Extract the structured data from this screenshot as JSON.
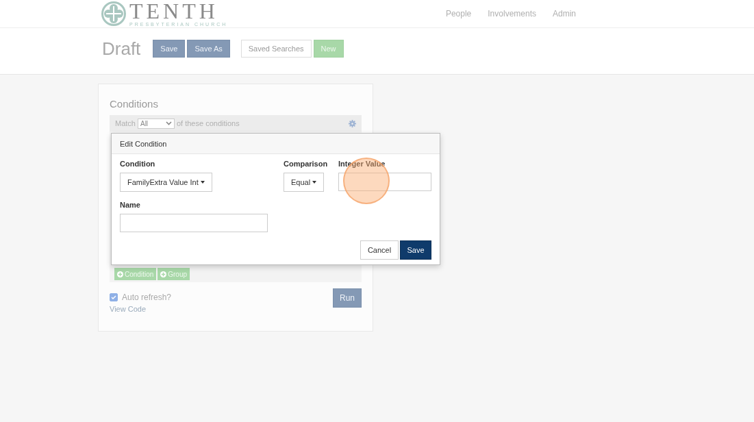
{
  "header": {
    "logo": {
      "name": "TENTH",
      "subtitle": "PRESBYTERIAN CHURCH"
    },
    "nav": [
      "People",
      "Involvements",
      "Admin"
    ]
  },
  "toolbar": {
    "title": "Draft",
    "buttons": [
      {
        "label": "Save",
        "kind": "primary"
      },
      {
        "label": "Save As",
        "kind": "primary"
      },
      {
        "label": "Saved Searches",
        "kind": "default"
      },
      {
        "label": "New",
        "kind": "success"
      }
    ]
  },
  "conditions": {
    "title": "Conditions",
    "match": {
      "prefix": "Match",
      "value": "All",
      "suffix": "of these conditions"
    },
    "add_buttons": [
      "Condition",
      "Group"
    ],
    "auto_refresh": {
      "label": "Auto refresh?",
      "checked": true
    },
    "run_button": "Run",
    "view_code": "View Code"
  },
  "dialog": {
    "title": "Edit Condition",
    "condition": {
      "label": "Condition",
      "value": "FamilyExtra Value Int"
    },
    "comparison": {
      "label": "Comparison",
      "value": "Equal"
    },
    "integer_value": {
      "label": "Integer Value"
    },
    "name": {
      "label": "Name"
    },
    "buttons": [
      {
        "label": "Cancel",
        "kind": "default"
      },
      {
        "label": "Save",
        "kind": "primary"
      }
    ]
  }
}
